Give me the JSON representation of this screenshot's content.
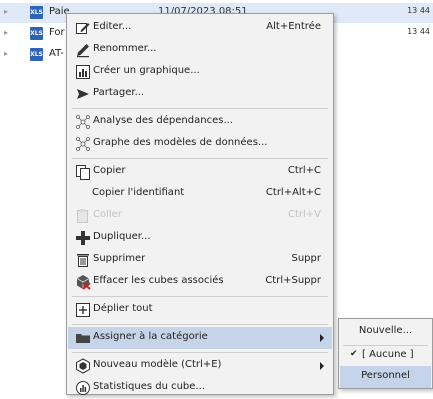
{
  "file_list": [
    {
      "name": "Paie",
      "date": "11/07/2023 08:51",
      "size": "13 44",
      "selected": true
    },
    {
      "name": "For",
      "date": "",
      "size": "13 44",
      "selected": false
    },
    {
      "name": "AT-",
      "date": "",
      "size": "",
      "selected": false
    }
  ],
  "file_icon_text": "XLS",
  "context_menu": {
    "edit": {
      "label": "Editer...",
      "shortcut": "Alt+Entrée"
    },
    "rename": {
      "label": "Renommer..."
    },
    "create_chart": {
      "label": "Créer un graphique..."
    },
    "share": {
      "label": "Partager..."
    },
    "dependencies": {
      "label": "Analyse des dépendances..."
    },
    "data_model_graph": {
      "label": "Graphe des modèles de données..."
    },
    "copy": {
      "label": "Copier",
      "shortcut": "Ctrl+C"
    },
    "copy_id": {
      "label": "Copier l'identifiant",
      "shortcut": "Ctrl+Alt+C"
    },
    "paste": {
      "label": "Coller",
      "shortcut": "Ctrl+V",
      "disabled": true
    },
    "duplicate": {
      "label": "Dupliquer..."
    },
    "delete": {
      "label": "Supprimer",
      "shortcut": "Suppr"
    },
    "clear_cubes": {
      "label": "Effacer les cubes associés",
      "shortcut": "Ctrl+Suppr"
    },
    "expand_all": {
      "label": "Déplier tout"
    },
    "assign_category": {
      "label": "Assigner à la catégorie",
      "highlighted": true
    },
    "new_model": {
      "label": "Nouveau modèle (Ctrl+E)"
    },
    "cube_stats": {
      "label": "Statistiques du cube..."
    }
  },
  "category_submenu": {
    "new": {
      "label": "Nouvelle..."
    },
    "none": {
      "label": "[ Aucune ]",
      "checked": true
    },
    "personnel": {
      "label": "Personnel",
      "highlighted": true
    }
  },
  "colors": {
    "selection": "#dfe9f7",
    "menu_highlight": "#c6d4ea",
    "menu_background": "#f2f2f2",
    "xls_icon": "#2f63b6"
  }
}
